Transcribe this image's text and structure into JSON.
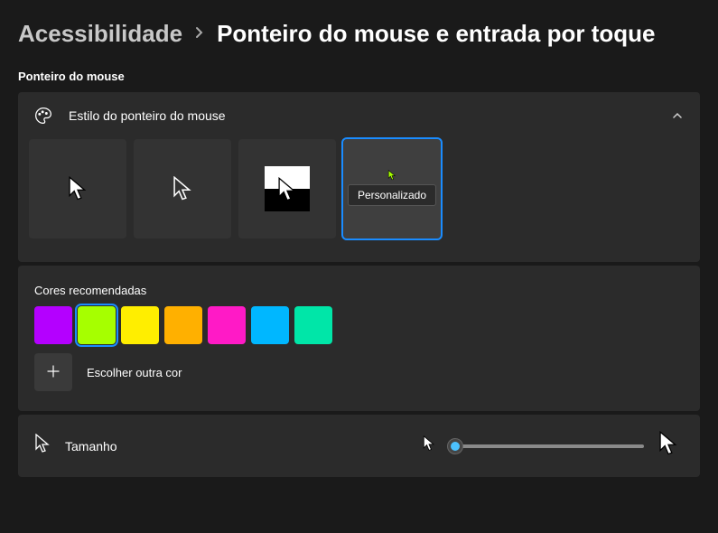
{
  "breadcrumb": {
    "parent": "Acessibilidade",
    "current": "Ponteiro do mouse e entrada por toque"
  },
  "section": {
    "title": "Ponteiro do mouse"
  },
  "style_card": {
    "label": "Estilo do ponteiro do mouse",
    "tooltip": "Personalizado"
  },
  "colors_card": {
    "label": "Cores recomendadas",
    "choose_label": "Escolher outra cor",
    "swatches": [
      "#b400ff",
      "#a6ff00",
      "#ffee00",
      "#ffb000",
      "#ff1ac6",
      "#00b7ff",
      "#00e6a8"
    ],
    "selected_index": 1
  },
  "size_card": {
    "label": "Tamanho"
  }
}
